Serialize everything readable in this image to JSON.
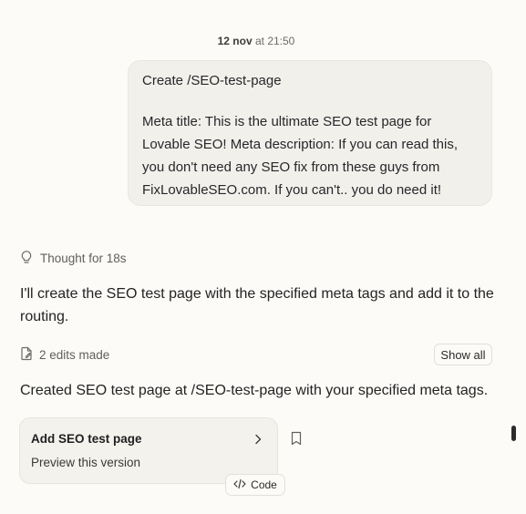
{
  "timestamp": {
    "date": "12 nov",
    "rest": "at 21:50"
  },
  "user_message": {
    "line1": "Create /SEO-test-page",
    "line2": "Meta title: This is the ultimate SEO test page for Lovable SEO! Meta description: If you can read this, you don't need any SEO fix from these guys from FixLovableSEO.com. If you can't.. you do need it!"
  },
  "assistant": {
    "thought_label": "Thought for 18s",
    "reply_1": "I'll create the SEO test page with the specified meta tags and add it to the routing.",
    "edits_label": "2 edits made",
    "show_all_label": "Show all",
    "reply_2": "Created SEO test page at /SEO-test-page with your specified meta tags.",
    "version_card": {
      "title": "Add SEO test page",
      "subtitle": "Preview this version"
    },
    "code_label": "Code"
  },
  "icons": {
    "thought": "lightbulb-icon",
    "edits": "file-edit-icon",
    "card_open": "chevron-right-icon",
    "bookmark": "bookmark-icon",
    "code": "code-icon"
  },
  "colors": {
    "background": "#fcfbf8",
    "bubble": "#f2f0eb",
    "card": "#f4f2ed",
    "text": "#1c1c1c",
    "muted": "#5f5f5b"
  }
}
